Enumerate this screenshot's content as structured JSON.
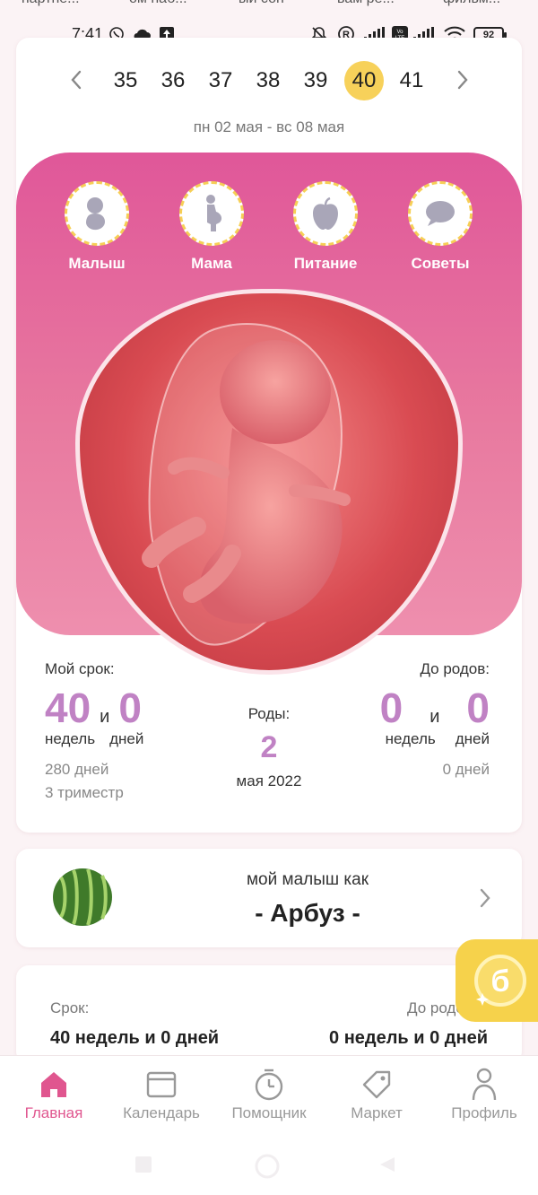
{
  "top_strip": [
    "партне...",
    "ом наб...",
    "ый сон",
    "вам ре...",
    "фильм..."
  ],
  "status_bar": {
    "time": "7:41",
    "battery": "92",
    "icons": [
      "viber-icon",
      "cloud-icon",
      "upload-icon",
      "mute-icon",
      "registered-icon",
      "signal-icon",
      "volte-icon",
      "signal2-icon",
      "wifi-icon"
    ]
  },
  "week_nav": {
    "weeks": [
      "35",
      "36",
      "37",
      "38",
      "39",
      "40",
      "41"
    ],
    "selected": "40",
    "date_range": "пн 02 мая - вс 08 мая"
  },
  "categories": [
    {
      "label": "Малыш",
      "icon": "baby-icon"
    },
    {
      "label": "Мама",
      "icon": "pregnant-woman-icon"
    },
    {
      "label": "Питание",
      "icon": "apple-icon"
    },
    {
      "label": "Советы",
      "icon": "chat-bubble-icon"
    }
  ],
  "my_term": {
    "title": "Мой срок:",
    "weeks": "40",
    "and": "и",
    "days": "0",
    "weeks_label": "недель",
    "days_label": "дней",
    "total_days": "280 дней",
    "trimester": "3 триместр"
  },
  "due": {
    "title": "Роды:",
    "day": "2",
    "month_year": "мая 2022"
  },
  "until_birth": {
    "title": "До родов:",
    "weeks": "0",
    "and": "и",
    "days": "0",
    "weeks_label": "недель",
    "days_label": "дней",
    "total_days": "0 дней"
  },
  "baby_size": {
    "caption": "мой малыш как",
    "fruit": "- Арбуз -"
  },
  "info_card": {
    "term_label": "Срок:",
    "term_value": "40 недель и 0 дней",
    "until_label": "До родов:",
    "until_value": "0 недель и 0 дней"
  },
  "bottom_nav": [
    {
      "label": "Главная",
      "icon": "home-icon",
      "active": true
    },
    {
      "label": "Календарь",
      "icon": "calendar-icon",
      "active": false
    },
    {
      "label": "Помощник",
      "icon": "timer-icon",
      "active": false
    },
    {
      "label": "Маркет",
      "icon": "tag-icon",
      "active": false
    },
    {
      "label": "Профиль",
      "icon": "profile-icon",
      "active": false
    }
  ],
  "colors": {
    "accent_pink": "#e0568f",
    "number_purple": "#c082c4",
    "week_highlight": "#f7d15a",
    "coin_yellow": "#f6d24b"
  }
}
